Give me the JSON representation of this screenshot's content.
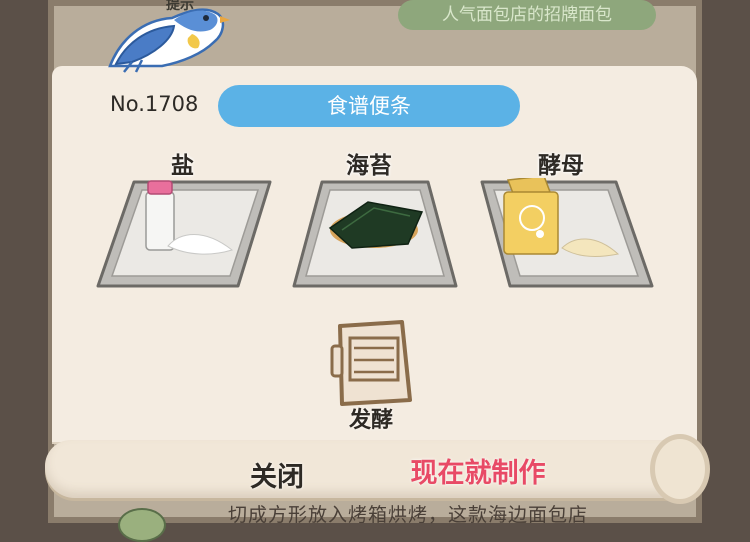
{
  "background": {
    "hint_label": "提示",
    "pill_text": "人气面包店的招牌面包",
    "description_text": "切成方形放入烤箱烘烤，这款海边面包店"
  },
  "recipe": {
    "number": "No.1708",
    "title": "食谱便条"
  },
  "ingredients": [
    {
      "name": "盐",
      "icon": "salt-icon"
    },
    {
      "name": "海苔",
      "icon": "seaweed-icon"
    },
    {
      "name": "酵母",
      "icon": "yeast-icon"
    }
  ],
  "step": {
    "name": "发酵",
    "icon": "proofing-box-icon"
  },
  "actions": {
    "close_label": "关闭",
    "make_label": "现在就制作"
  },
  "colors": {
    "title_pill": "#5bb2e6",
    "make_button_text": "#e84a66",
    "parchment": "#f4ece1"
  }
}
